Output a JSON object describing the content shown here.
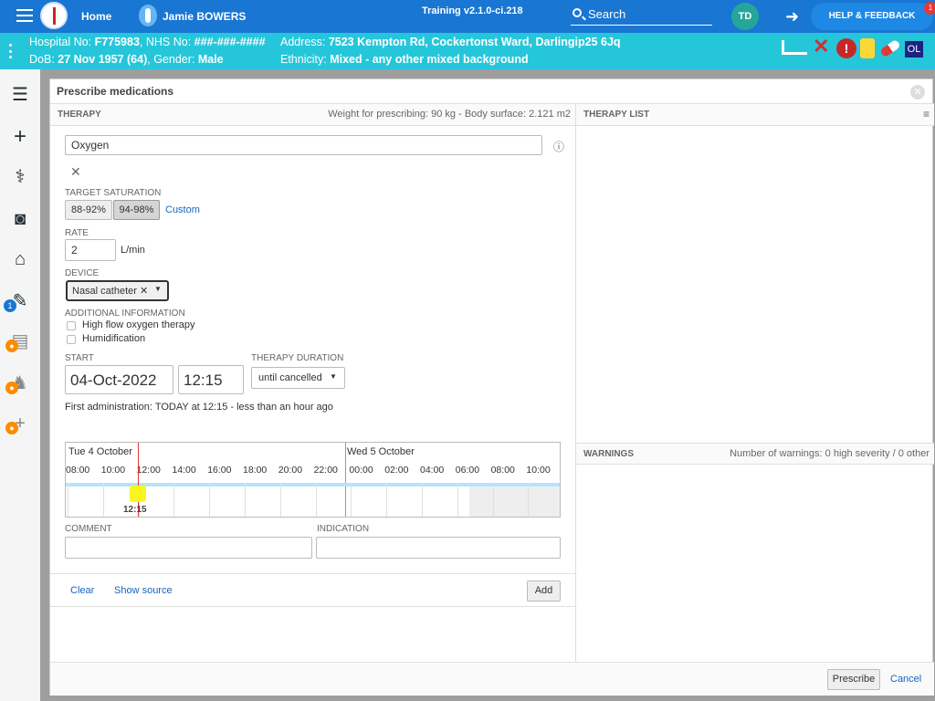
{
  "topbar": {
    "home": "Home",
    "patient_name": "Jamie BOWERS",
    "training": "Training v2.1.0-ci.218",
    "search": "Search",
    "initials": "TD",
    "help": "HELP & FEEDBACK",
    "help_badge": "1"
  },
  "banner": {
    "line1_left_lbl": "Hospital No: ",
    "hosp_no": "F775983",
    "nhs_lbl": ", NHS No: ",
    "nhs_no": "###-###-####",
    "line1_right_lbl": "Address: ",
    "address": "7523 Kempton Rd, Cockertonst Ward, Darlingip25 6Jq",
    "dob_lbl": "DoB: ",
    "dob": "27 Nov 1957 (64)",
    "gender_lbl": ", Gender: ",
    "gender": "Male",
    "eth_lbl": "Ethnicity: ",
    "ethnicity": "Mixed - any other mixed background",
    "ol": "OL"
  },
  "sidebar": {
    "badge1": "1"
  },
  "modal": {
    "title": "Prescribe medications",
    "therapy_head": "THERAPY",
    "weight": "Weight for prescribing: 90 kg - Body surface: 2.121 m2",
    "therapy_list": "THERAPY LIST",
    "warnings_head": "WARNINGS",
    "warnings_count": "Number of warnings: 0 high severity / 0 other"
  },
  "form": {
    "medication": "Oxygen",
    "target_sat_lbl": "TARGET SATURATION",
    "sat_options": [
      "88-92%",
      "94-98%"
    ],
    "custom": "Custom",
    "rate_lbl": "RATE",
    "rate": "2",
    "rate_unit": "L/min",
    "device_lbl": "DEVICE",
    "device": "Nasal catheter",
    "addinfo_lbl": "ADDITIONAL INFORMATION",
    "opt_highflow": "High flow oxygen therapy",
    "opt_humid": "Humidification",
    "start_lbl": "START",
    "start_date": "04-Oct-2022",
    "start_time": "12:15",
    "duration_lbl": "THERAPY DURATION",
    "duration": "until cancelled",
    "first_admin": "First administration: TODAY at 12:15 - less than an hour ago",
    "comment_lbl": "COMMENT",
    "indication_lbl": "INDICATION"
  },
  "timeline": {
    "day1": "Tue 4 October",
    "day2": "Wed 5 October",
    "hours": [
      "08:00",
      "10:00",
      "12:00",
      "14:00",
      "16:00",
      "18:00",
      "20:00",
      "22:00",
      "00:00",
      "02:00",
      "04:00",
      "06:00",
      "08:00",
      "10:00"
    ],
    "marker": "12:15"
  },
  "actions": {
    "clear": "Clear",
    "show_source": "Show source",
    "add": "Add",
    "prescribe": "Prescribe",
    "cancel": "Cancel"
  }
}
